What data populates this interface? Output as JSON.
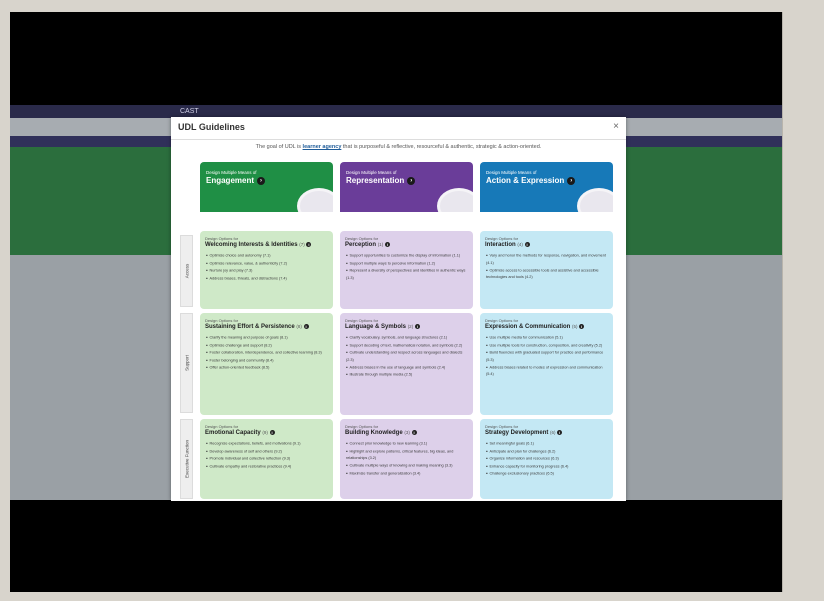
{
  "site": {
    "logo": "CAST"
  },
  "modal": {
    "title": "UDL Guidelines",
    "close": "×",
    "goal_prefix": "The goal of UDL is ",
    "goal_link": "learner agency",
    "goal_suffix": " that is purposeful & reflective, resourceful & authentic, strategic & action-oriented."
  },
  "columns": [
    {
      "small": "Design Multiple Means of",
      "title": "Engagement",
      "color": "#1f8f45"
    },
    {
      "small": "Design Multiple Means of",
      "title": "Representation",
      "color": "#6a3d99"
    },
    {
      "small": "Design Multiple Means of",
      "title": "Action & Expression",
      "color": "#1779b8"
    }
  ],
  "rows": [
    {
      "label": "Access"
    },
    {
      "label": "Support"
    },
    {
      "label": "Executive Function"
    }
  ],
  "cells": {
    "eng_1": {
      "kicker": "Design Options for",
      "title": "Welcoming Interests & Identities",
      "num": "(7)",
      "items": [
        "Optimize choice and autonomy (7.1)",
        "Optimize relevance, value, & authenticity (7.2)",
        "Nurture joy and play (7.3)",
        "Address biases, threats, and distractions (7.4)"
      ]
    },
    "rep_1": {
      "kicker": "Design Options for",
      "title": "Perception",
      "num": "(1)",
      "items": [
        "Support opportunities to customize the display of information (1.1)",
        "Support multiple ways to perceive information (1.2)",
        "Represent a diversity of perspectives and identities in authentic ways (1.3)"
      ]
    },
    "act_1": {
      "kicker": "Design Options for",
      "title": "Interaction",
      "num": "(4)",
      "items": [
        "Vary and honor the methods for response, navigation, and movement (4.1)",
        "Optimize access to accessible tools and assistive and accessible technologies and tools (4.2)"
      ]
    },
    "eng_2": {
      "kicker": "Design Options for",
      "title": "Sustaining Effort & Persistence",
      "num": "(8)",
      "items": [
        "Clarify the meaning and purpose of goals (8.1)",
        "Optimize challenge and support (8.2)",
        "Foster collaboration, interdependence, and collective learning (8.3)",
        "Foster belonging and community (8.4)",
        "Offer action-oriented feedback (8.5)"
      ]
    },
    "rep_2": {
      "kicker": "Design Options for",
      "title": "Language & Symbols",
      "num": "(2)",
      "items": [
        "Clarify vocabulary, symbols, and language structures (2.1)",
        "Support decoding of text, mathematical notation, and symbols (2.2)",
        "Cultivate understanding and respect across languages and dialects (2.3)",
        "Address biases in the use of language and symbols (2.4)",
        "Illustrate through multiple media (2.5)"
      ]
    },
    "act_2": {
      "kicker": "Design Options for",
      "title": "Expression & Communication",
      "num": "(5)",
      "items": [
        "Use multiple media for communication (5.1)",
        "Use multiple tools for construction, composition, and creativity (5.2)",
        "Build fluencies with graduated support for practice and performance (5.3)",
        "Address biases related to modes of expression and communication (5.4)"
      ]
    },
    "eng_3": {
      "kicker": "Design Options for",
      "title": "Emotional Capacity",
      "num": "(9)",
      "items": [
        "Recognize expectations, beliefs, and motivations (9.1)",
        "Develop awareness of self and others (9.2)",
        "Promote individual and collective reflection (9.3)",
        "Cultivate empathy and restorative practices (9.4)"
      ]
    },
    "rep_3": {
      "kicker": "Design Options for",
      "title": "Building Knowledge",
      "num": "(3)",
      "items": [
        "Connect prior knowledge to new learning (3.1)",
        "Highlight and explore patterns, critical features, big ideas, and relationships (3.2)",
        "Cultivate multiple ways of knowing and making meaning (3.3)",
        "Maximize transfer and generalization (3.4)"
      ]
    },
    "act_3": {
      "kicker": "Design Options for",
      "title": "Strategy Development",
      "num": "(6)",
      "items": [
        "Set meaningful goals (6.1)",
        "Anticipate and plan for challenges (6.2)",
        "Organize information and resources (6.3)",
        "Enhance capacity for monitoring progress (6.4)",
        "Challenge exclusionary practices (6.5)"
      ]
    }
  }
}
